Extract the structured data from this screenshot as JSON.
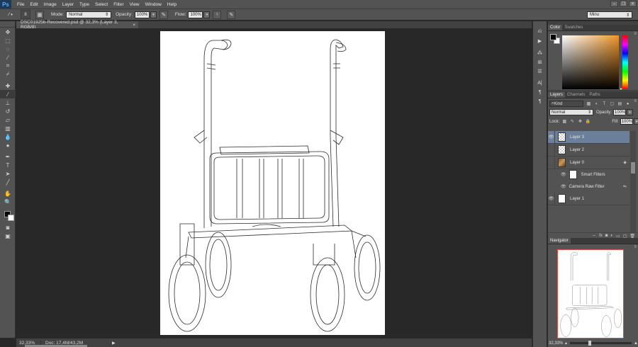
{
  "app": {
    "logo": "Ps"
  },
  "menu": [
    {
      "label": "File",
      "key": "F"
    },
    {
      "label": "Edit",
      "key": "E"
    },
    {
      "label": "Image",
      "key": "I"
    },
    {
      "label": "Layer",
      "key": "L"
    },
    {
      "label": "Type",
      "key": "T"
    },
    {
      "label": "Select",
      "key": "S"
    },
    {
      "label": "Filter",
      "key": "T"
    },
    {
      "label": "View",
      "key": "V"
    },
    {
      "label": "Window",
      "key": "W"
    },
    {
      "label": "Help",
      "key": "H"
    }
  ],
  "window_controls": [
    "–",
    "❐",
    "✕"
  ],
  "options": {
    "brush_size": "8",
    "mode_label": "Mode:",
    "mode_value": "Normal",
    "opacity_label": "Opacity:",
    "opacity_value": "100%",
    "flow_label": "Flow:",
    "flow_value": "100%",
    "workspace": "Minu"
  },
  "document": {
    "tab_title": "DSC01925b-Recovered.psd @ 32,3% (Layer 3, RGB/8)",
    "tab_close": "×"
  },
  "status": {
    "zoom": "32,33%",
    "doc_info": "Doc: 17,4M/43,2M",
    "arrow": "▶"
  },
  "color_panel": {
    "tabs": [
      "Color",
      "Swatches"
    ],
    "fg_color": "#000000",
    "bg_color": "#ffffff",
    "base_hue": "#f0962a"
  },
  "layers_panel": {
    "tabs": [
      "Layers",
      "Channels",
      "Paths"
    ],
    "kind_label": "Kind",
    "blend_mode": "Normal",
    "opacity_label": "Opacity:",
    "opacity_value": "100%",
    "lock_label": "Lock:",
    "fill_label": "Fill:",
    "fill_value": "100%",
    "layers": [
      {
        "name": "Layer 3",
        "visible": true,
        "selected": true,
        "thumb": "checker"
      },
      {
        "name": "Layer 2",
        "visible": false,
        "selected": false,
        "thumb": "checker"
      },
      {
        "name": "Layer 0",
        "visible": false,
        "selected": false,
        "thumb": "photo"
      },
      {
        "name": "Layer 1",
        "visible": true,
        "selected": false,
        "thumb": "white"
      }
    ],
    "smart_filters_label": "Smart Filters",
    "camera_raw_label": "Camera Raw Filter"
  },
  "navigator_panel": {
    "tab": "Navigator",
    "zoom": "32,33%",
    "view_box_color": "#e34c4c"
  }
}
